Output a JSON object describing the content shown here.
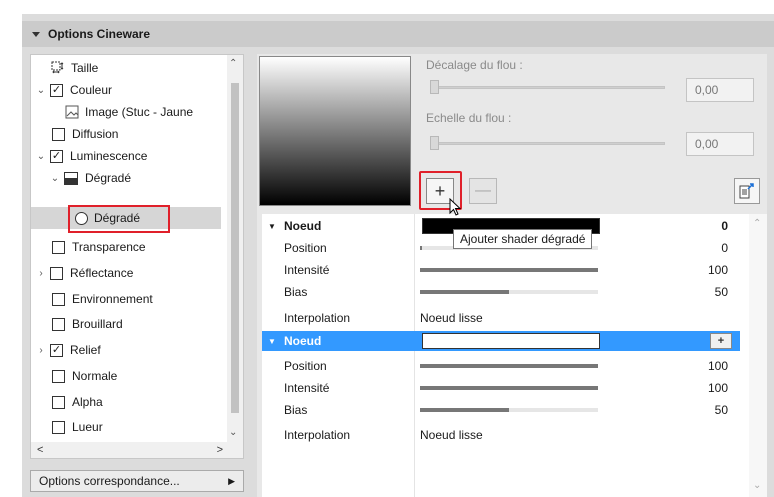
{
  "panel": {
    "title": "Options Cineware"
  },
  "tree": {
    "items": [
      {
        "label": "Taille",
        "indent": 0,
        "kind": "size"
      },
      {
        "label": "Couleur",
        "indent": 0,
        "kind": "check",
        "checked": true,
        "expanded": true
      },
      {
        "label": "Image (Stuc - Jaune",
        "indent": 1,
        "kind": "image"
      },
      {
        "label": "Diffusion",
        "indent": 0,
        "kind": "check",
        "checked": false
      },
      {
        "label": "Luminescence",
        "indent": 0,
        "kind": "check",
        "checked": true,
        "expanded": true
      },
      {
        "label": "Dégradé",
        "indent": 1,
        "kind": "gradient",
        "expanded": true
      },
      {
        "label": "Dégradé",
        "indent": 2,
        "kind": "radio",
        "selected": true
      },
      {
        "label": "Transparence",
        "indent": 0,
        "kind": "check",
        "checked": false
      },
      {
        "label": "Réflectance",
        "indent": 0,
        "kind": "check",
        "checked": false,
        "collapsed": true
      },
      {
        "label": "Environnement",
        "indent": 0,
        "kind": "check",
        "checked": false
      },
      {
        "label": "Brouillard",
        "indent": 0,
        "kind": "check",
        "checked": false
      },
      {
        "label": "Relief",
        "indent": 0,
        "kind": "check",
        "checked": true,
        "collapsed": true
      },
      {
        "label": "Normale",
        "indent": 0,
        "kind": "check",
        "checked": false
      },
      {
        "label": "Alpha",
        "indent": 0,
        "kind": "check",
        "checked": false
      },
      {
        "label": "Lueur",
        "indent": 0,
        "kind": "check",
        "checked": false
      }
    ],
    "options_button": "Options correspondance..."
  },
  "settings": {
    "blur_offset_label": "Décalage du flou :",
    "blur_offset_value": "0,00",
    "blur_scale_label": "Echelle du flou :",
    "blur_scale_value": "0,00",
    "add_button": "+",
    "remove_button": "—"
  },
  "tooltip": "Ajouter shader dégradé",
  "gradient_table": {
    "nodes": [
      {
        "header": "Noeud",
        "header_value": "0",
        "selected": false,
        "rows": [
          {
            "name": "Position",
            "value": "0",
            "level": 0.0
          },
          {
            "name": "Intensité",
            "value": "100",
            "level": 1.0
          },
          {
            "name": "Bias",
            "value": "50",
            "level": 0.5
          },
          {
            "name": "Interpolation",
            "text": "Noeud lisse"
          }
        ]
      },
      {
        "header": "Noeud",
        "header_value": "+",
        "selected": true,
        "rows": [
          {
            "name": "Position",
            "value": "100",
            "level": 1.0
          },
          {
            "name": "Intensité",
            "value": "100",
            "level": 1.0
          },
          {
            "name": "Bias",
            "value": "50",
            "level": 0.5
          },
          {
            "name": "Interpolation",
            "text": "Noeud lisse"
          }
        ]
      }
    ]
  },
  "colors": {
    "selection_blue": "#3399ff",
    "highlight_red": "#e0202a"
  }
}
